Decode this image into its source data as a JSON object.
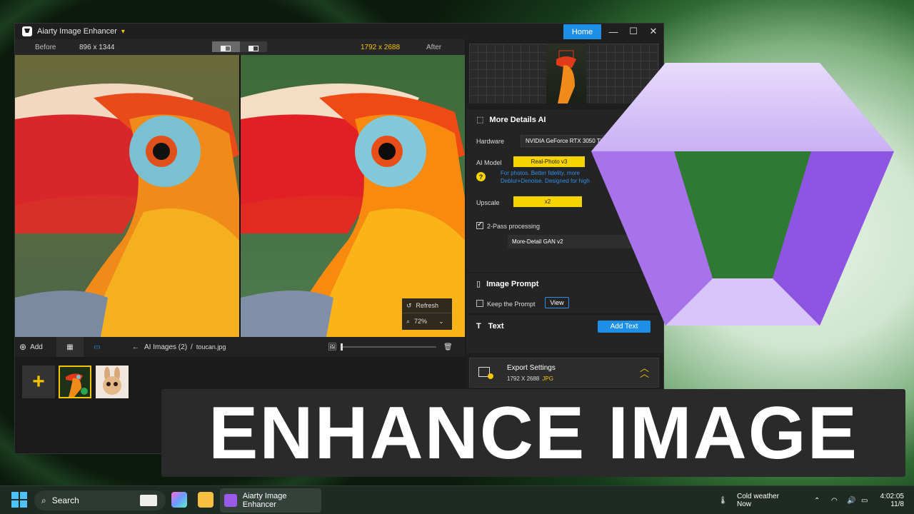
{
  "window": {
    "title": "Aiarty Image Enhancer",
    "home_label": "Home",
    "minimize": "—",
    "maximize": "☐",
    "close": "✕"
  },
  "compare": {
    "before_label": "Before",
    "before_dim": "896 x 1344",
    "after_dim": "1792 x 2688",
    "after_label": "After"
  },
  "zoom": {
    "refresh_label": "Refresh",
    "zoom_level": "72%"
  },
  "bottombar": {
    "add_label": "Add",
    "breadcrumb_root": "AI Images (2)",
    "breadcrumb_sep": "/",
    "breadcrumb_file": "toucan.jpg"
  },
  "settings": {
    "section_title": "More Details AI",
    "hardware_label": "Hardware",
    "hardware_value": "NVIDIA GeForce RTX 3050 Ti",
    "model_label": "AI Model",
    "model_value": "Real-Photo v3",
    "model_desc": "For photos. Better fidelity, more\nDeblur+Denoise. Designed for high",
    "upscale_label": "Upscale",
    "upscale_value": "x2",
    "twopass_label": "2-Pass processing",
    "twopass_checked": true,
    "gan_value": "More-Detail GAN v2"
  },
  "prompt": {
    "section_title": "Image Prompt",
    "keep_label": "Keep the Prompt",
    "view_label": "View"
  },
  "text": {
    "section_title": "Text",
    "add_text_label": "Add Text"
  },
  "export": {
    "title": "Export Settings",
    "size": "1792 X 2688",
    "format": "JPG"
  },
  "banner": {
    "text": "ENHANCE IMAGE"
  },
  "taskbar": {
    "search_label": "Search",
    "app_label": "Aiarty Image Enhancer",
    "weather_title": "Cold weather",
    "weather_sub": "Now",
    "time": "4:02:05",
    "date": "11/8"
  },
  "colors": {
    "accent_blue": "#1e8fe6",
    "accent_yellow": "#f5d400",
    "logo_purple": "#9a5ce8"
  }
}
